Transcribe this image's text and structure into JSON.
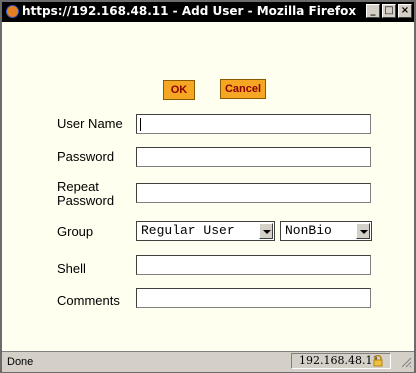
{
  "window": {
    "title": "https://192.168.48.11 - Add User - Mozilla Firefox",
    "minimize": "_",
    "maximize": "□",
    "close": "×"
  },
  "buttons": {
    "ok": "OK",
    "cancel": "Cancel"
  },
  "form": {
    "username_label": "User Name",
    "password_label": "Password",
    "repeat_label_line1": "Repeat",
    "repeat_label_line2": "Password",
    "group_label": "Group",
    "shell_label": "Shell",
    "comments_label": "Comments",
    "username_value": "",
    "password_value": "",
    "repeat_value": "",
    "shell_value": "",
    "comments_value": "",
    "group_selected": "Regular User",
    "bio_selected": "NonBio"
  },
  "status": {
    "text": "Done",
    "host": "192.168.48.11"
  },
  "icons": {
    "window": "firefox-icon",
    "lock": "lock-icon",
    "grip": "resize-grip-icon"
  },
  "colors": {
    "button_bg": "#f5a623",
    "button_text": "#8b0000",
    "page_bg": "#fffff0"
  }
}
